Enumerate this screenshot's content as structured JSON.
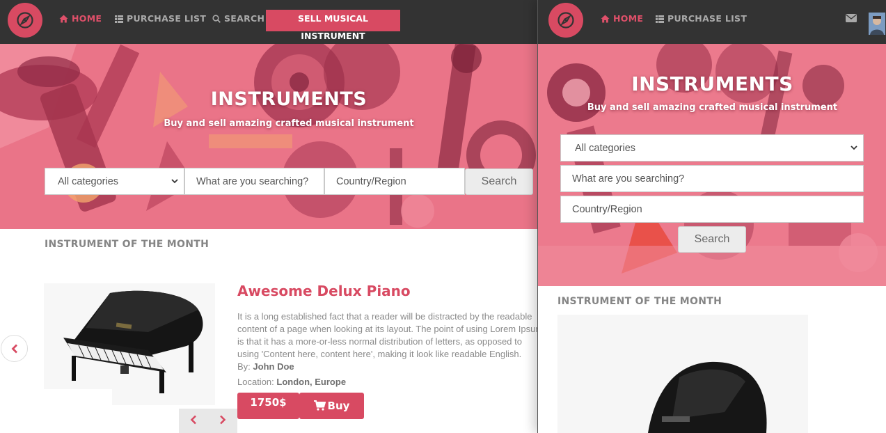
{
  "colors": {
    "accent": "#d84a62",
    "nav_bg": "#333333",
    "hero": "#e96f84"
  },
  "left": {
    "nav": {
      "logo_icon": "compass-icon",
      "home": "HOME",
      "purchase_list": "PURCHASE LIST",
      "search": "SEARCH",
      "sell": "SELL MUSICAL INSTRUMENT"
    },
    "hero": {
      "title": "INSTRUMENTS",
      "subtitle": "Buy and sell amazing crafted musical instrument"
    },
    "search_form": {
      "category_selected": "All categories",
      "query_placeholder": "What are you searching?",
      "region_placeholder": "Country/Region",
      "button": "Search"
    },
    "section_title": "INSTRUMENT OF THE MONTH",
    "product": {
      "title": "Awesome Delux Piano",
      "description": "It is a long established fact that a reader will be distracted by the readable content of a page when looking at its layout. The point of using Lorem Ipsum is that it has a more-or-less normal distribution of letters, as opposed to using 'Content here, content here', making it look like readable English.",
      "by_label": "By:",
      "by_value": "John Doe",
      "location_label": "Location:",
      "location_value": "London, Europe",
      "price": "1750$",
      "buy": "Buy"
    }
  },
  "right": {
    "nav": {
      "logo_icon": "compass-icon",
      "home": "HOME",
      "purchase_list": "PURCHASE LIST",
      "mail_icon": "envelope-icon",
      "avatar_icon": "user-avatar"
    },
    "hero": {
      "title": "INSTRUMENTS",
      "subtitle": "Buy and sell amazing crafted musical instrument"
    },
    "search_form": {
      "category_selected": "All categories",
      "query_placeholder": "What are you searching?",
      "region_placeholder": "Country/Region",
      "button": "Search"
    },
    "section_title": "INSTRUMENT OF THE MONTH"
  }
}
